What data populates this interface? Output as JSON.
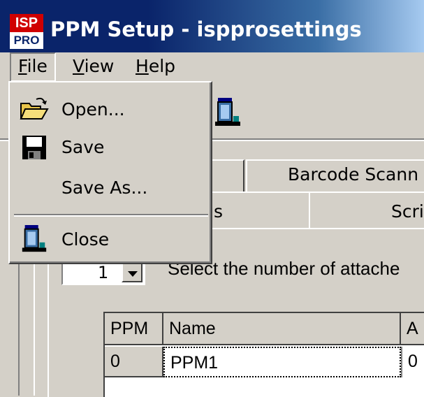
{
  "window": {
    "app_icon_top": "ISP",
    "app_icon_bottom": "PRO",
    "title": "PPM Setup - ispprosettings"
  },
  "menubar": {
    "file": {
      "prefix": "",
      "accel": "F",
      "rest": "ile"
    },
    "view": {
      "prefix": "",
      "accel": "V",
      "rest": "iew"
    },
    "help": {
      "prefix": "",
      "accel": "H",
      "rest": "elp"
    }
  },
  "file_menu": {
    "open_label": "Open...",
    "save_label": "Save",
    "save_as_label": "Save As...",
    "close_label": "Close"
  },
  "tabs": {
    "back_row": "Barcode Scann",
    "front_left_partial": "s",
    "front_right_partial": "Scri"
  },
  "ppm_count": {
    "value": "1",
    "label": "Select the number of attache"
  },
  "grid": {
    "headers": [
      "PPM",
      "Name",
      "A"
    ],
    "rows": [
      [
        "0",
        "PPM1",
        "0"
      ]
    ]
  },
  "colors": {
    "titlebar_start": "#0a246a",
    "titlebar_end": "#a6caf0",
    "face": "#d4d0c8"
  }
}
